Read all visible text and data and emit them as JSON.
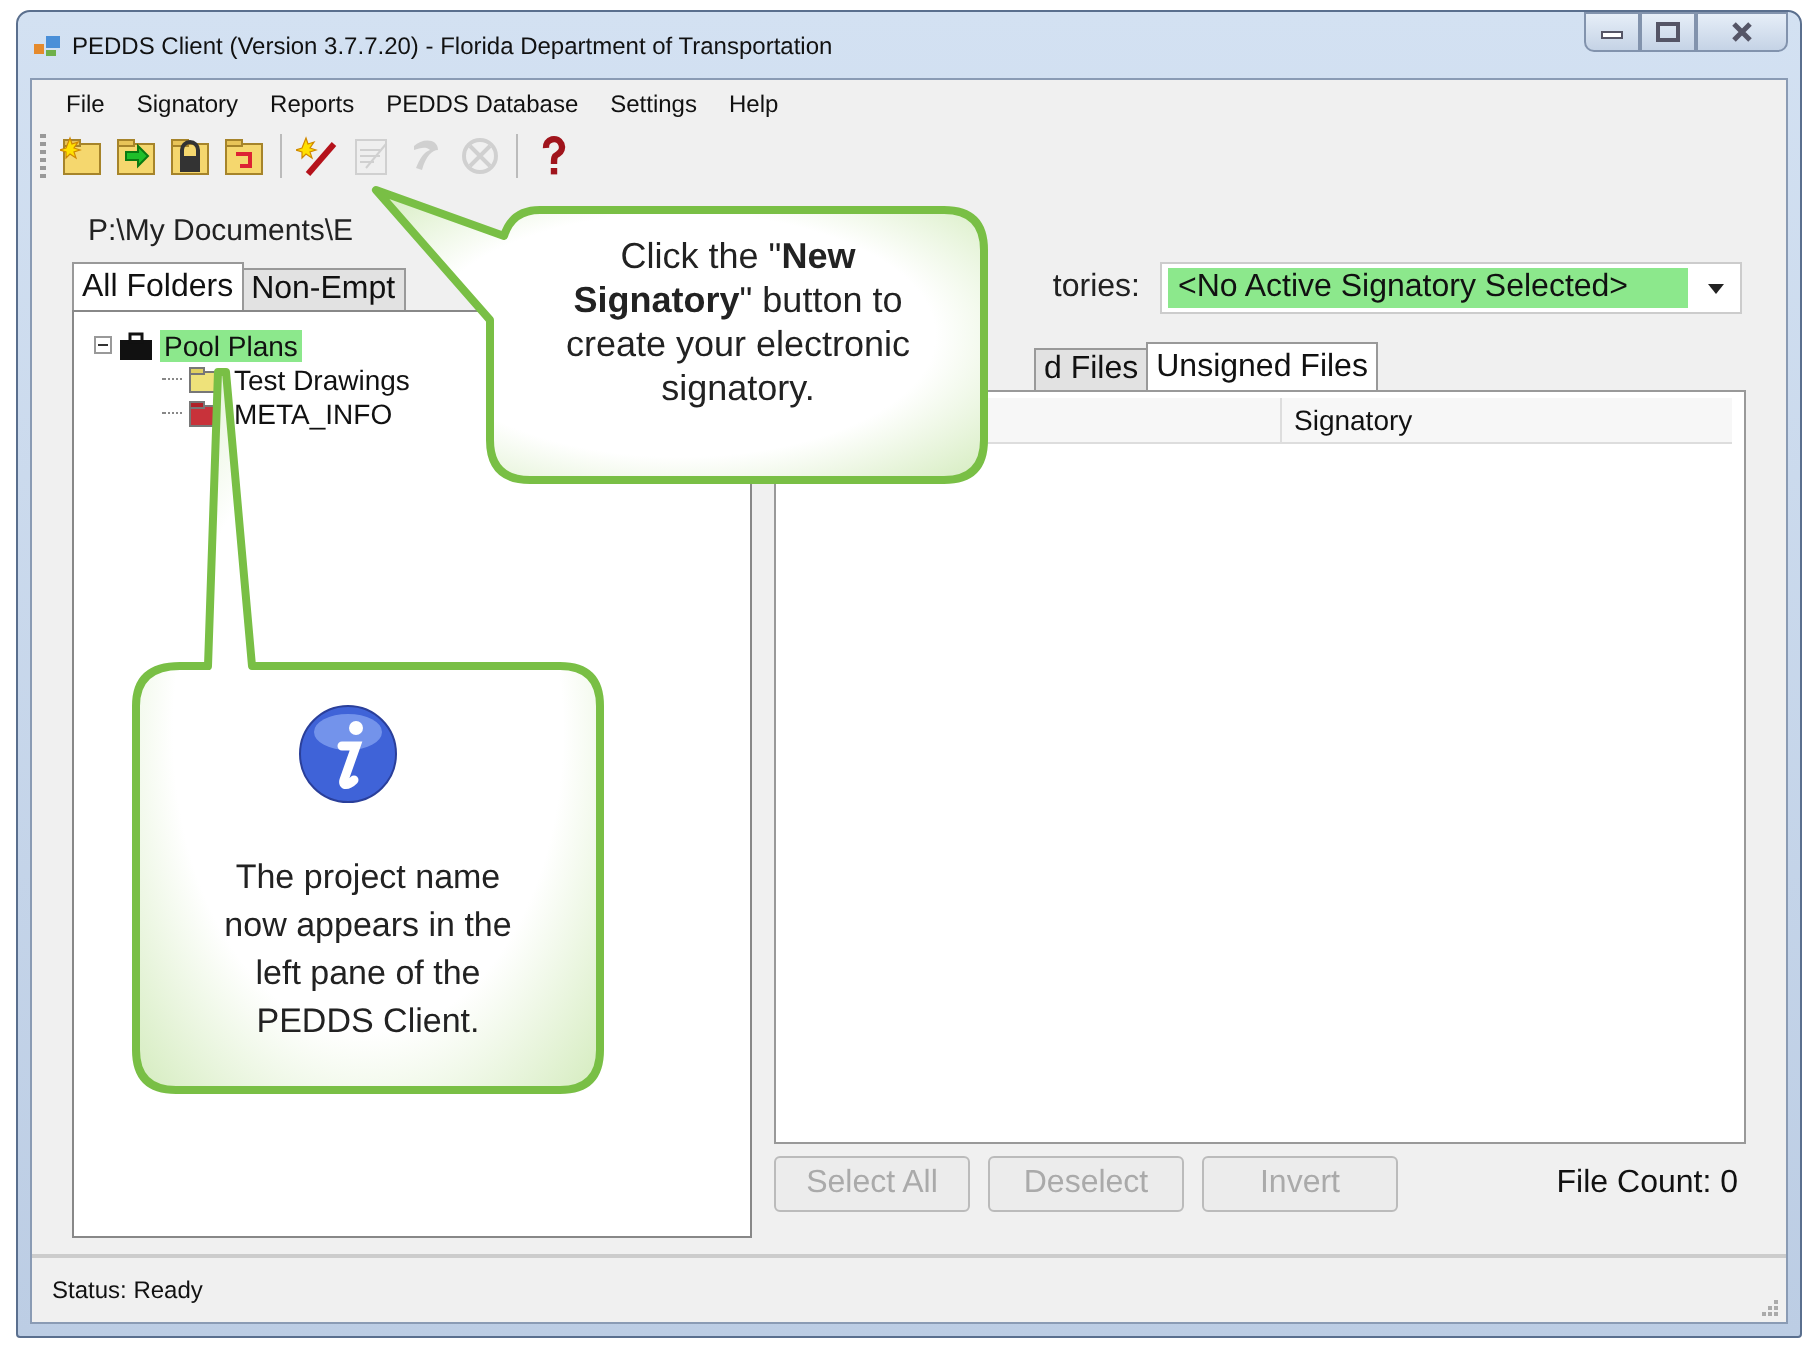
{
  "window": {
    "title": "PEDDS Client (Version 3.7.7.20) - Florida Department of Transportation"
  },
  "menu": [
    "File",
    "Signatory",
    "Reports",
    "PEDDS Database",
    "Settings",
    "Help"
  ],
  "toolbar": [
    [
      {
        "kind": "new-folder",
        "disabled": false
      },
      {
        "kind": "import-folder",
        "disabled": false
      },
      {
        "kind": "lock-folder",
        "disabled": false
      },
      {
        "kind": "export-folder",
        "disabled": false
      }
    ],
    [
      {
        "kind": "new-signatory",
        "disabled": false
      },
      {
        "kind": "sign-document",
        "disabled": true
      },
      {
        "kind": "verify",
        "disabled": true
      },
      {
        "kind": "cancel",
        "disabled": true
      }
    ],
    [
      {
        "kind": "help",
        "disabled": false
      }
    ]
  ],
  "left_pane": {
    "path": "P:\\My Documents\\E",
    "tabs": [
      {
        "label": "All Folders",
        "selected": true
      },
      {
        "label": "Non-Empt",
        "selected": false
      }
    ],
    "tree": [
      {
        "label": "Pool Plans",
        "kind": "project",
        "highlighted": true,
        "expanded": true,
        "children": [
          {
            "label": "Test Drawings",
            "kind": "folder"
          },
          {
            "label": "META_INFO",
            "kind": "meta-folder"
          }
        ]
      }
    ]
  },
  "right_pane": {
    "signatory_label": "tories:",
    "signatory_value": "<No Active Signatory Selected>",
    "tabs": [
      {
        "label": "d Files",
        "selected": false
      },
      {
        "label": "Unsigned Files",
        "selected": true
      }
    ],
    "columns": [
      "Signatory"
    ],
    "buttons": [
      {
        "label": "Select All",
        "disabled": true
      },
      {
        "label": "Deselect",
        "disabled": true
      },
      {
        "label": "Invert",
        "disabled": true
      }
    ],
    "file_count": "File Count: 0"
  },
  "status_bar": "Status: Ready",
  "callouts": [
    {
      "kind": "top",
      "text": "Click the \"**New Signatory**\" button to create your electronic signatory."
    },
    {
      "kind": "info",
      "text": "The project name now appears in the left pane of the PEDDS Client."
    }
  ]
}
